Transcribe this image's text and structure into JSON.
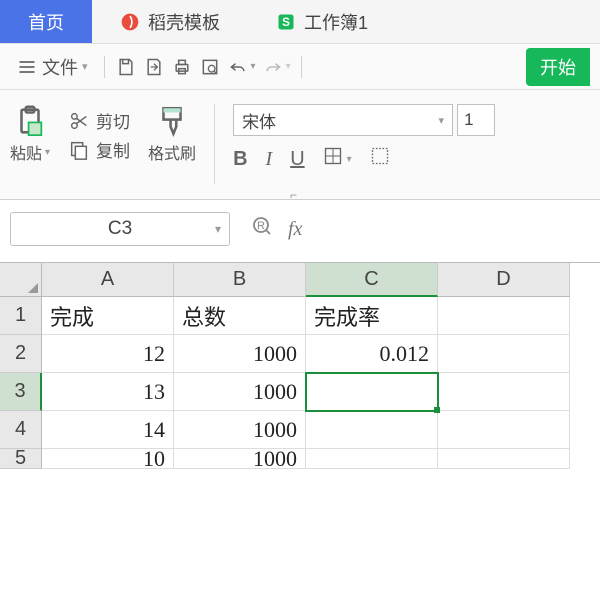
{
  "tabs": {
    "home": "首页",
    "template": "稻壳模板",
    "workbook": "工作簿1"
  },
  "menubar": {
    "file": "文件",
    "start": "开始"
  },
  "ribbon": {
    "paste": "粘贴",
    "cut": "剪切",
    "copy": "复制",
    "format_painter": "格式刷",
    "font_name": "宋体",
    "font_size": "1",
    "bold": "B",
    "italic": "I",
    "underline": "U"
  },
  "namebox": {
    "ref": "C3"
  },
  "columns": [
    "A",
    "B",
    "C",
    "D"
  ],
  "rows": [
    "1",
    "2",
    "3",
    "4",
    "5"
  ],
  "data": {
    "r1": {
      "a": "完成",
      "b": "总数",
      "c": "完成率",
      "d": ""
    },
    "r2": {
      "a": "12",
      "b": "1000",
      "c": "0.012",
      "d": ""
    },
    "r3": {
      "a": "13",
      "b": "1000",
      "c": "",
      "d": ""
    },
    "r4": {
      "a": "14",
      "b": "1000",
      "c": "",
      "d": ""
    },
    "r5": {
      "a": "10",
      "b": "1000",
      "c": "",
      "d": ""
    }
  },
  "active_cell": "C3"
}
